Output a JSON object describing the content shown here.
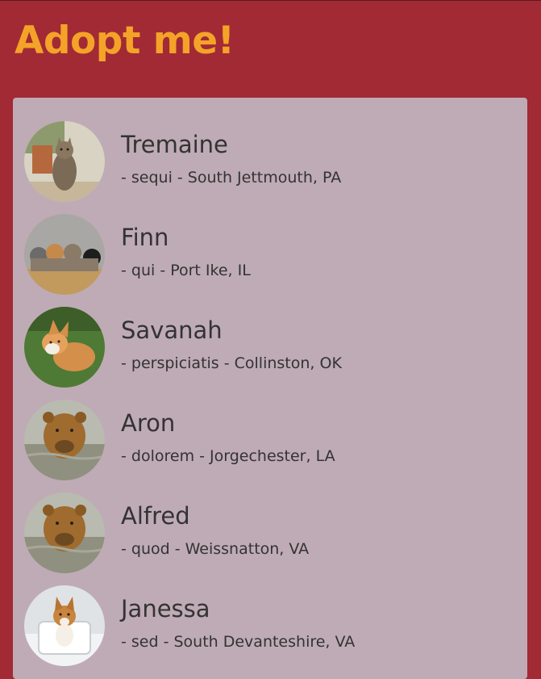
{
  "header": {
    "title": "Adopt me!"
  },
  "pets": [
    {
      "name": "Tremaine",
      "details": "- sequi - South Jettmouth, PA",
      "photo_icon": "cat-photo-icon"
    },
    {
      "name": "Finn",
      "details": "- qui - Port Ike, IL",
      "photo_icon": "kittens-photo-icon"
    },
    {
      "name": "Savanah",
      "details": "- perspiciatis - Collinston, OK",
      "photo_icon": "corgi-photo-icon"
    },
    {
      "name": "Aron",
      "details": "- dolorem - Jorgechester, LA",
      "photo_icon": "bear-photo-icon"
    },
    {
      "name": "Alfred",
      "details": "- quod - Weissnatton, VA",
      "photo_icon": "bear-photo-icon"
    },
    {
      "name": "Janessa",
      "details": "- sed - South Devanteshire, VA",
      "photo_icon": "puppy-photo-icon"
    }
  ],
  "colors": {
    "background": "#a22a35",
    "title": "#f4a328",
    "panel": "#bfabb5",
    "text": "#333333"
  }
}
